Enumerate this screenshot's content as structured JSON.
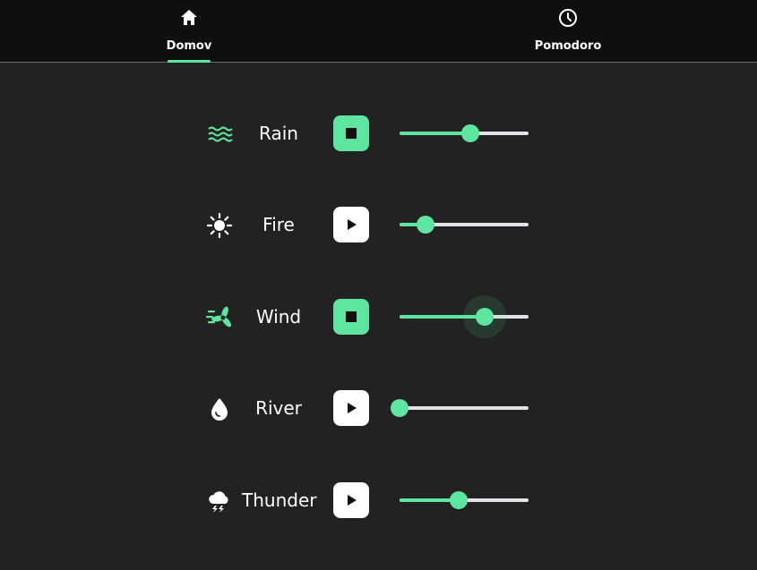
{
  "tabs": [
    {
      "label": "Domov",
      "icon": "home-icon",
      "selected": true
    },
    {
      "label": "Pomodoro",
      "icon": "clock-icon",
      "selected": false
    }
  ],
  "colors": {
    "accent": "#5ee6a0",
    "background": "#222222",
    "tabbar": "#0f0f0f",
    "track": "#e6e0e9"
  },
  "sounds": [
    {
      "name": "Rain",
      "icon": "waves-icon",
      "icon_color": "#5ee6a0",
      "playing": true,
      "volume": 0.55,
      "focused": false
    },
    {
      "name": "Fire",
      "icon": "sun-icon",
      "icon_color": "#ffffff",
      "playing": false,
      "volume": 0.2,
      "focused": false
    },
    {
      "name": "Wind",
      "icon": "wind-turbine-icon",
      "icon_color": "#5ee6a0",
      "playing": true,
      "volume": 0.66,
      "focused": true
    },
    {
      "name": "River",
      "icon": "water-drop-icon",
      "icon_color": "#ffffff",
      "playing": false,
      "volume": 0.0,
      "focused": false
    },
    {
      "name": "Thunder",
      "icon": "thunderstorm-icon",
      "icon_color": "#ffffff",
      "playing": false,
      "volume": 0.46,
      "focused": false
    }
  ]
}
